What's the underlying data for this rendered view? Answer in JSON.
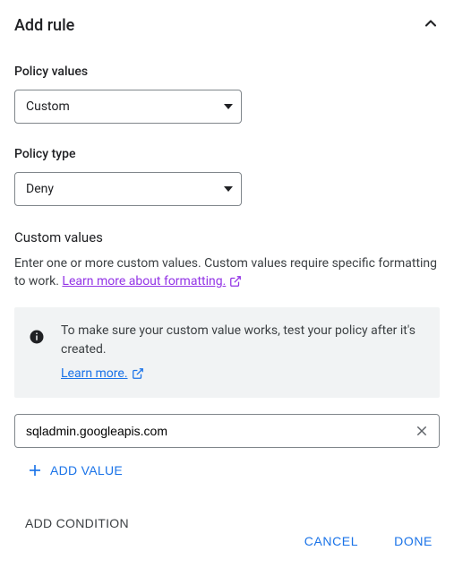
{
  "header": {
    "title": "Add rule"
  },
  "policyValues": {
    "label": "Policy values",
    "selected": "Custom"
  },
  "policyType": {
    "label": "Policy type",
    "selected": "Deny"
  },
  "customValues": {
    "heading": "Custom values",
    "helper": "Enter one or more custom values. Custom values require specific formatting to work. ",
    "learnFormatting": "Learn more about formatting."
  },
  "infoBox": {
    "message": "To make sure your custom value works, test your policy after it's created.",
    "learnMore": "Learn more."
  },
  "valueInput": {
    "value": "sqladmin.googleapis.com"
  },
  "buttons": {
    "addValue": "ADD VALUE",
    "addCondition": "ADD CONDITION",
    "cancel": "CANCEL",
    "done": "DONE"
  }
}
